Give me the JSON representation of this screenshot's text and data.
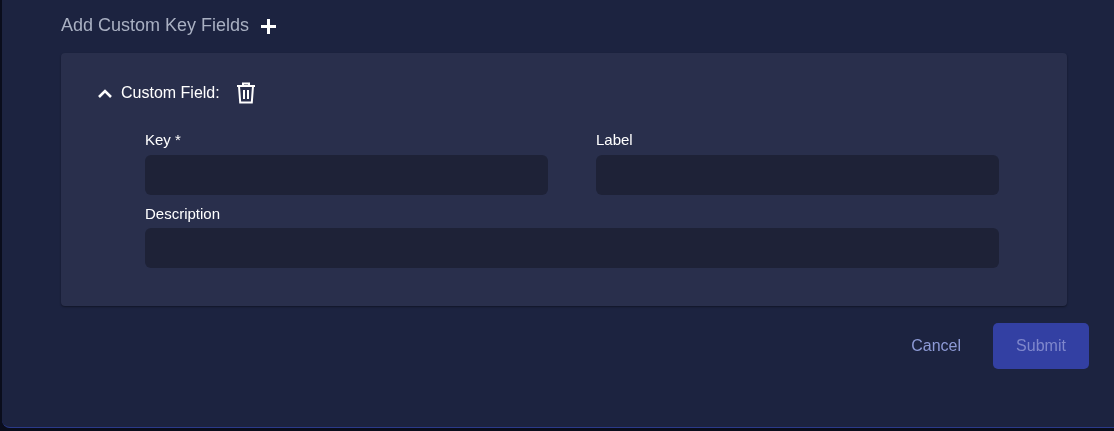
{
  "section": {
    "title": "Add Custom Key Fields"
  },
  "custom_field": {
    "title": "Custom Field:",
    "expanded": true,
    "fields": [
      {
        "label": "Key *",
        "kind": "half"
      },
      {
        "label": "Label",
        "kind": "half"
      },
      {
        "label": "Description",
        "kind": "full"
      }
    ]
  },
  "buttons": [
    {
      "label": "Cancel",
      "kind": "text",
      "disabled": false
    },
    {
      "label": "Submit",
      "kind": "primary",
      "disabled": true
    }
  ]
}
